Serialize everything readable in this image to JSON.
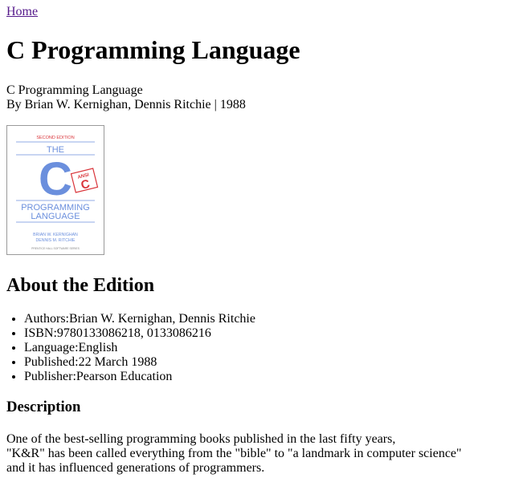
{
  "nav": {
    "home_label": "Home"
  },
  "book": {
    "title": "C Programming Language",
    "subtitle": "C Programming Language",
    "byline": "By Brian W. Kernighan, Dennis Ritchie | 1988",
    "cover": {
      "edition": "SECOND EDITION",
      "the": "THE",
      "letter": "C",
      "badge_top": "ANSI",
      "badge_letter": "C",
      "line1": "PROGRAMMING",
      "line2": "LANGUAGE",
      "author1": "BRIAN W. KERNIGHAN",
      "author2": "DENNIS M. RITCHIE",
      "series": "PRENTICE HALL SOFTWARE SERIES",
      "accent_blue": "#6b8fdd",
      "accent_red": "#d9343a"
    }
  },
  "edition": {
    "heading": "About the Edition",
    "details": [
      {
        "label": "Authors:",
        "value": "Brian W. Kernighan, Dennis Ritchie"
      },
      {
        "label": "ISBN:",
        "value": "9780133086218, 0133086216"
      },
      {
        "label": "Language:",
        "value": "English"
      },
      {
        "label": "Published:",
        "value": "22 March 1988"
      },
      {
        "label": "Publisher:",
        "value": "Pearson Education"
      }
    ]
  },
  "description": {
    "heading": "Description",
    "lines": [
      "One of the best-selling programming books published in the last fifty years,",
      "\"K&R\" has been called everything from the \"bible\" to \"a landmark in computer science\"",
      "and it has influenced generations of programmers."
    ]
  }
}
